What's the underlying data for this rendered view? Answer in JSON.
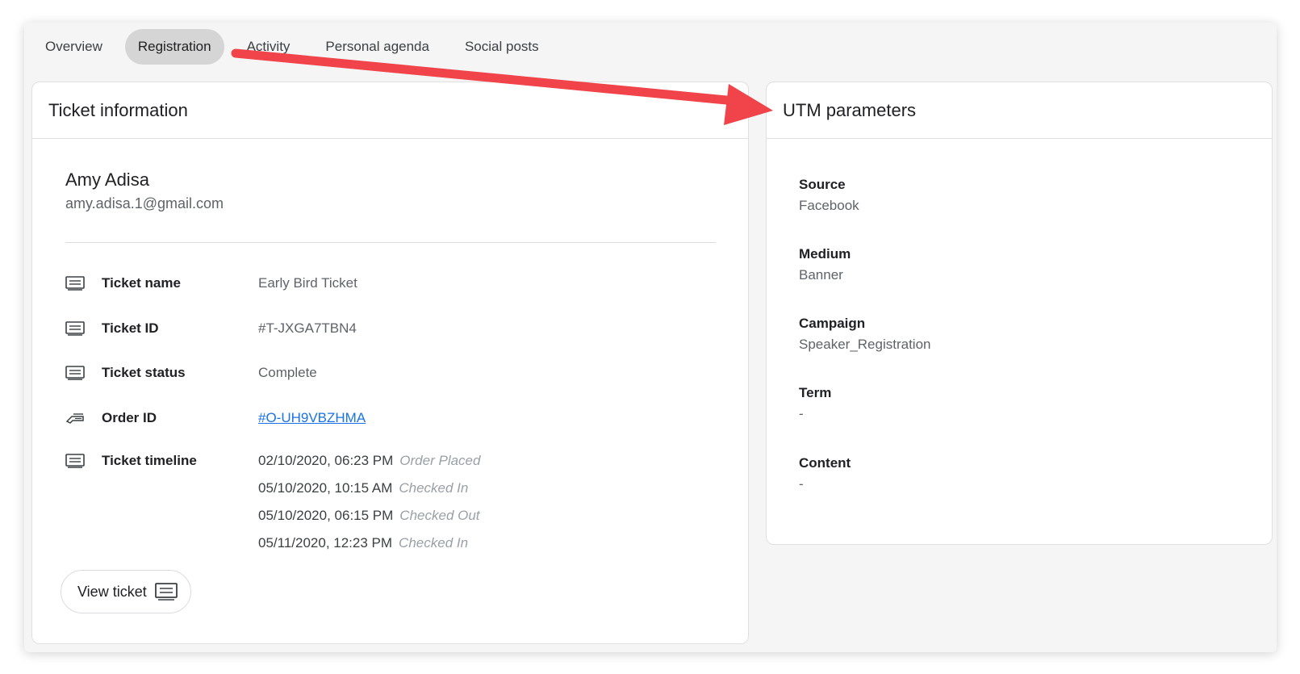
{
  "tabs": [
    {
      "label": "Overview",
      "active": false
    },
    {
      "label": "Registration",
      "active": true
    },
    {
      "label": "Activity",
      "active": false
    },
    {
      "label": "Personal agenda",
      "active": false
    },
    {
      "label": "Social posts",
      "active": false
    }
  ],
  "ticket_card": {
    "title": "Ticket information",
    "name": "Amy Adisa",
    "email": "amy.adisa.1@gmail.com",
    "rows": [
      {
        "label": "Ticket name",
        "value": "Early Bird Ticket",
        "icon": "ticket-icon"
      },
      {
        "label": "Ticket ID",
        "value": "#T-JXGA7TBN4",
        "icon": "ticket-icon"
      },
      {
        "label": "Ticket status",
        "value": "Complete",
        "icon": "ticket-icon"
      },
      {
        "label": "Order ID",
        "value": "#O-UH9VBZHMA",
        "icon": "order-icon"
      }
    ],
    "timeline_label": "Ticket timeline",
    "timeline": [
      {
        "date": "02/10/2020, 06:23 PM",
        "status": "Order Placed"
      },
      {
        "date": "05/10/2020, 10:15 AM",
        "status": "Checked In"
      },
      {
        "date": "05/10/2020, 06:15 PM",
        "status": "Checked Out"
      },
      {
        "date": "05/11/2020, 12:23 PM",
        "status": "Checked In"
      }
    ],
    "view_ticket_label": "View ticket"
  },
  "utm_card": {
    "title": "UTM parameters",
    "items": [
      {
        "label": "Source",
        "value": "Facebook"
      },
      {
        "label": "Medium",
        "value": "Banner"
      },
      {
        "label": "Campaign",
        "value": "Speaker_Registration"
      },
      {
        "label": "Term",
        "value": "-"
      },
      {
        "label": "Content",
        "value": "-"
      }
    ]
  },
  "colors": {
    "accent_link": "#1a73e8",
    "annotation_arrow": "#f0444a",
    "active_tab_bg": "#d5d5d5"
  }
}
